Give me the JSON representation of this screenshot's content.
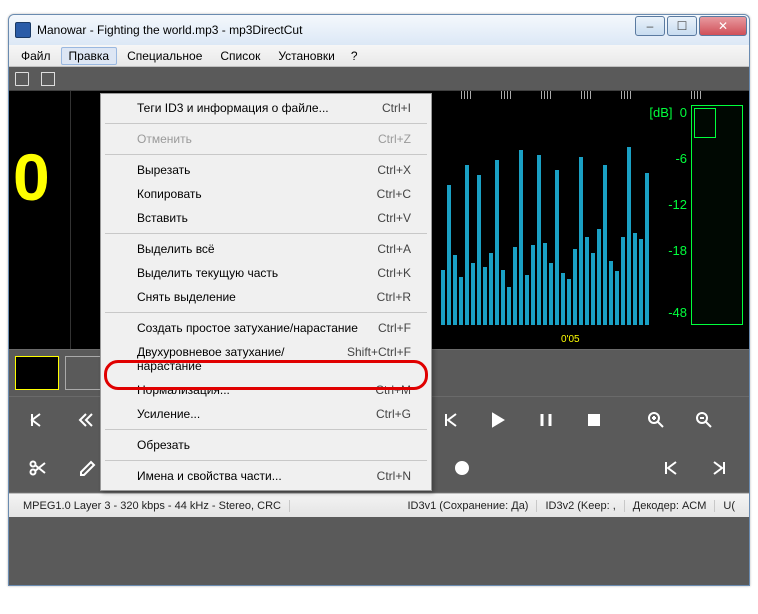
{
  "window": {
    "title": "Manowar - Fighting the world.mp3 - mp3DirectCut"
  },
  "menubar": {
    "items": [
      "Файл",
      "Правка",
      "Специальное",
      "Список",
      "Установки"
    ],
    "help": "?"
  },
  "dropdown": {
    "tags_info": {
      "label": "Теги ID3 и информация о файле...",
      "shortcut": "Ctrl+I"
    },
    "undo": {
      "label": "Отменить",
      "shortcut": "Ctrl+Z"
    },
    "cut": {
      "label": "Вырезать",
      "shortcut": "Ctrl+X"
    },
    "copy": {
      "label": "Копировать",
      "shortcut": "Ctrl+C"
    },
    "paste": {
      "label": "Вставить",
      "shortcut": "Ctrl+V"
    },
    "select_all": {
      "label": "Выделить всё",
      "shortcut": "Ctrl+A"
    },
    "select_current": {
      "label": "Выделить текущую часть",
      "shortcut": "Ctrl+K"
    },
    "deselect": {
      "label": "Снять выделение",
      "shortcut": "Ctrl+R"
    },
    "simple_fade": {
      "label": "Создать простое затухание/нарастание",
      "shortcut": "Ctrl+F"
    },
    "two_level_fade": {
      "label": "Двухуровневое затухание/нарастание",
      "shortcut": "Shift+Ctrl+F"
    },
    "normalize": {
      "label": "Нормализация...",
      "shortcut": "Ctrl+M"
    },
    "gain": {
      "label": "Усиление...",
      "shortcut": "Ctrl+G"
    },
    "trim": {
      "label": "Обрезать",
      "shortcut": ""
    },
    "part_props": {
      "label": "Имена и свойства части...",
      "shortcut": "Ctrl+N"
    }
  },
  "waveform": {
    "big_label": "0",
    "db_header": "[dB]",
    "db_values": [
      "0",
      "-6",
      "-12",
      "-18",
      "-48"
    ],
    "time_marker": "0'05"
  },
  "status": {
    "format": "MPEG1.0 Layer 3 - 320 kbps - 44 kHz - Stereo, CRC",
    "id3v1": "ID3v1 (Сохранение: Да)",
    "id3v2": "ID3v2 (Keep: ,",
    "decoder": "Декодер: ACM",
    "extra": "U("
  },
  "colors": {
    "waveform": "#1aa0c4",
    "accent_yellow": "#ffff00",
    "accent_green": "#00ff3c",
    "annotation": "#e00000"
  }
}
